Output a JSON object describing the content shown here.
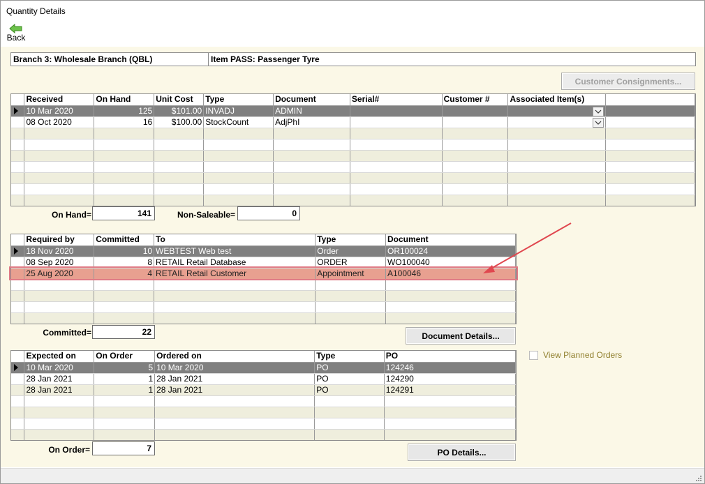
{
  "window": {
    "title": "Quantity Details"
  },
  "toolbar": {
    "back_label": "Back"
  },
  "info": {
    "branch": "Branch 3:  Wholesale Branch (QBL)",
    "item": "Item PASS:  Passenger Tyre"
  },
  "buttons": {
    "customer_consignments": "Customer Consignments...",
    "document_details": "Document Details...",
    "po_details": "PO Details..."
  },
  "stock": {
    "columns": [
      "Received",
      "On Hand",
      "Unit Cost",
      "Type",
      "Document",
      "Serial#",
      "Customer #",
      "Associated Item(s)"
    ],
    "rows": [
      [
        "10 Mar 2020",
        "125",
        "$101.00",
        "INVADJ",
        "ADMIN",
        "",
        "",
        ""
      ],
      [
        "08 Oct 2020",
        "16",
        "$100.00",
        "StockCount",
        "AdjPhI",
        "",
        "",
        ""
      ]
    ],
    "on_hand_label": "On Hand=",
    "on_hand_value": "141",
    "non_saleable_label": "Non-Saleable=",
    "non_saleable_value": "0"
  },
  "committed": {
    "columns": [
      "Required by",
      "Committed",
      "To",
      "Type",
      "Document"
    ],
    "rows": [
      [
        "18 Nov 2020",
        "10",
        "WEBTEST Web test",
        "Order",
        "OR100024"
      ],
      [
        "08 Sep 2020",
        "8",
        "RETAIL Retail Database",
        "ORDER",
        "WO100040"
      ],
      [
        "25 Aug 2020",
        "4",
        "RETAIL Retail Customer",
        "Appointment",
        "A100046"
      ]
    ],
    "total_label": "Committed=",
    "total_value": "22"
  },
  "orders": {
    "columns": [
      "Expected on",
      "On Order",
      "Ordered on",
      "Type",
      "PO"
    ],
    "rows": [
      [
        "10 Mar 2020",
        "5",
        "10 Mar 2020",
        "PO",
        "124246"
      ],
      [
        "28 Jan 2021",
        "1",
        "28 Jan 2021",
        "PO",
        "124290"
      ],
      [
        "28 Jan 2021",
        "1",
        "28 Jan 2021",
        "PO",
        "124291"
      ]
    ],
    "total_label": "On Order=",
    "total_value": "7"
  },
  "view_planned_orders": "View Planned Orders",
  "colors": {
    "background": "#fbf8e7",
    "selected_row": "#808080",
    "highlight_row": "#e8a090",
    "annotation": "#e0474f"
  }
}
